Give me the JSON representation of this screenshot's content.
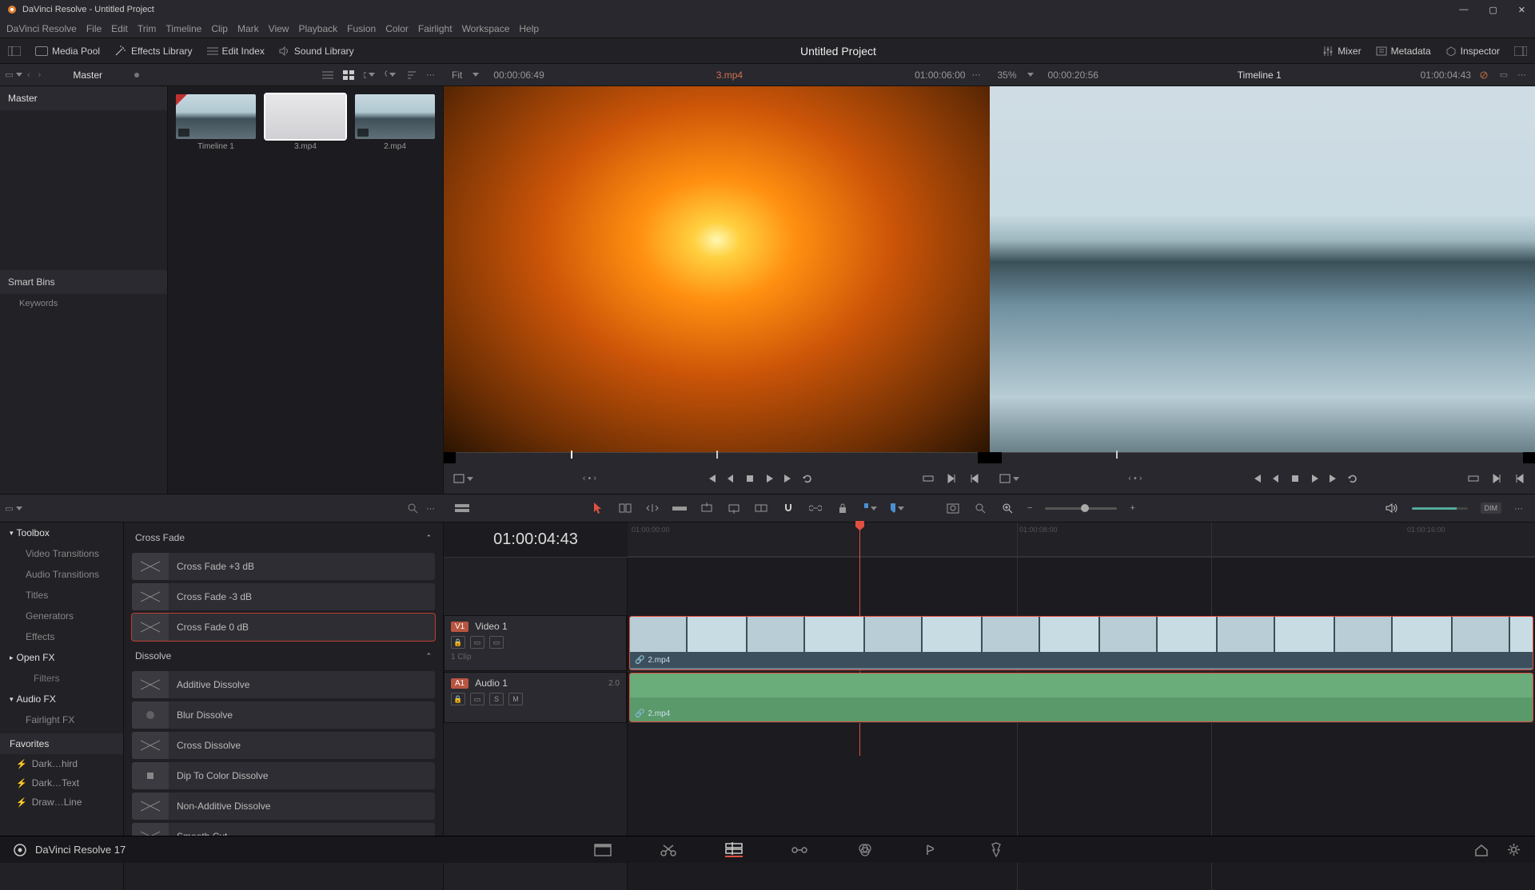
{
  "app_title": "DaVinci Resolve - Untitled Project",
  "menu": [
    "DaVinci Resolve",
    "File",
    "Edit",
    "Trim",
    "Timeline",
    "Clip",
    "Mark",
    "View",
    "Playback",
    "Fusion",
    "Color",
    "Fairlight",
    "Workspace",
    "Help"
  ],
  "workspace": {
    "left": [
      {
        "label": "Media Pool"
      },
      {
        "label": "Effects Library"
      },
      {
        "label": "Edit Index"
      },
      {
        "label": "Sound Library"
      }
    ],
    "project": "Untitled Project",
    "right": [
      {
        "label": "Mixer"
      },
      {
        "label": "Metadata"
      },
      {
        "label": "Inspector"
      }
    ]
  },
  "upper": {
    "bin": "Master",
    "fit_label": "Fit",
    "source_tc": "00:00:06:49",
    "source_name": "3.mp4",
    "source_dur": "01:00:06:00",
    "zoom": "35%",
    "timeline_tc": "00:00:20:56",
    "timeline_name": "Timeline 1",
    "timeline_dur": "01:00:04:43"
  },
  "bins": {
    "master": "Master",
    "smart": "Smart Bins",
    "keywords": "Keywords"
  },
  "clips": [
    {
      "name": "Timeline 1",
      "kind": "timeline"
    },
    {
      "name": "3.mp4",
      "kind": "video",
      "selected": true
    },
    {
      "name": "2.mp4",
      "kind": "video"
    }
  ],
  "fx_sidebar": {
    "toolbox": "Toolbox",
    "items": [
      "Video Transitions",
      "Audio Transitions",
      "Titles",
      "Generators",
      "Effects"
    ],
    "openfx": "Open FX",
    "filters": "Filters",
    "audiofx": "Audio FX",
    "fairlight": "Fairlight FX",
    "favorites": "Favorites",
    "favs": [
      "Dark…hird",
      "Dark…Text",
      "Draw…Line"
    ]
  },
  "fx_groups": [
    {
      "name": "Cross Fade",
      "items": [
        "Cross Fade +3 dB",
        "Cross Fade -3 dB",
        "Cross Fade 0 dB"
      ]
    },
    {
      "name": "Dissolve",
      "items": [
        "Additive Dissolve",
        "Blur Dissolve",
        "Cross Dissolve",
        "Dip To Color Dissolve",
        "Non-Additive Dissolve",
        "Smooth Cut"
      ]
    }
  ],
  "timeline": {
    "timecode": "01:00:04:43",
    "ticks": [
      "01:00:00:00",
      "01:00:08:00",
      "01:00:16:00"
    ],
    "video_track": {
      "badge": "V1",
      "name": "Video 1",
      "clip_count": "1 Clip"
    },
    "audio_track": {
      "badge": "A1",
      "name": "Audio 1",
      "ch": "2.0",
      "s": "S",
      "m": "M"
    },
    "clip_name": "2.mp4"
  },
  "footer": {
    "app": "DaVinci Resolve 17"
  }
}
